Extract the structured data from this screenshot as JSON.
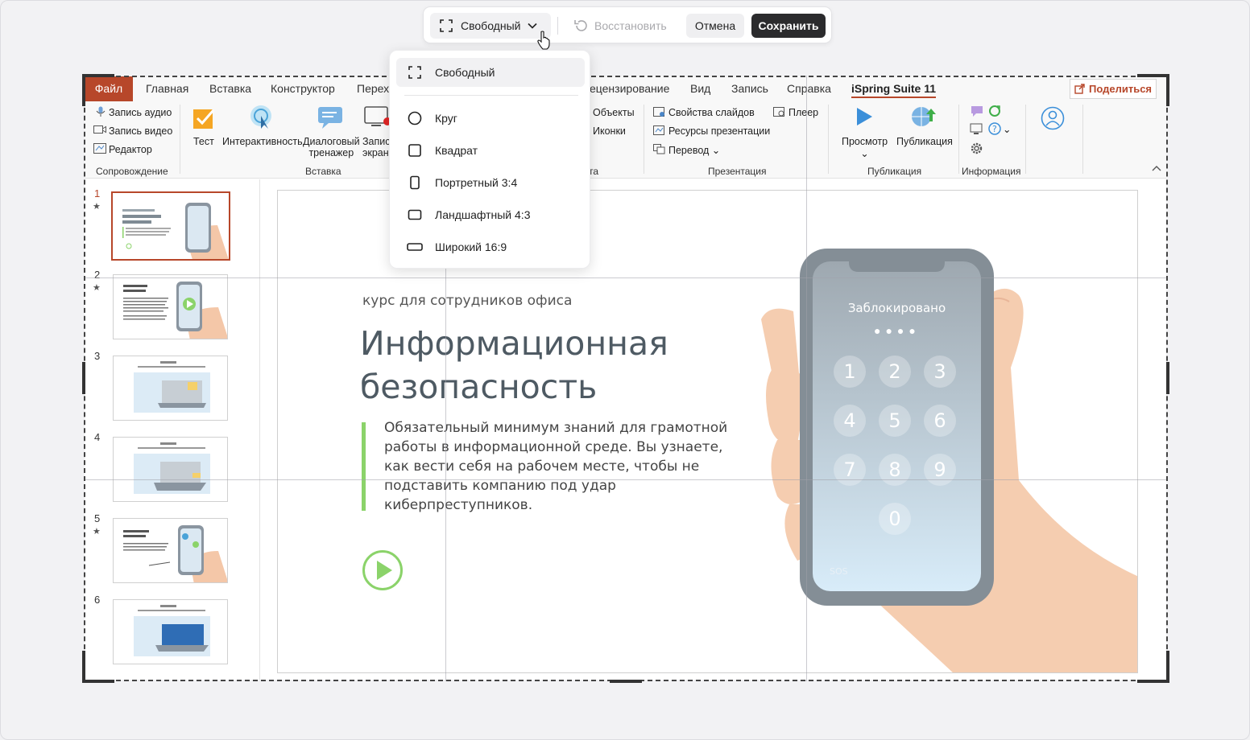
{
  "toolbar": {
    "mode_label": "Свободный",
    "restore_label": "Восстановить",
    "cancel_label": "Отмена",
    "save_label": "Сохранить"
  },
  "dropdown": {
    "items": [
      {
        "label": "Свободный",
        "icon": "free-crop-icon"
      },
      {
        "label": "Круг",
        "icon": "circle-icon"
      },
      {
        "label": "Квадрат",
        "icon": "square-icon"
      },
      {
        "label": "Портретный 3:4",
        "icon": "portrait-icon"
      },
      {
        "label": "Ландшафтный 4:3",
        "icon": "landscape-icon"
      },
      {
        "label": "Широкий 16:9",
        "icon": "wide-icon"
      }
    ]
  },
  "ribbon": {
    "tabs": [
      "Файл",
      "Главная",
      "Вставка",
      "Конструктор",
      "Перехо",
      "ецензирование",
      "Вид",
      "Запись",
      "Справка",
      "iSpring Suite 11"
    ],
    "share_label": "Поделиться",
    "accompaniment": {
      "items": [
        "Запись аудио",
        "Запись видео",
        "Редактор"
      ],
      "group": "Сопровождение"
    },
    "insert": {
      "test": "Тест",
      "interactivity": "Интерактивность",
      "dialog_1": "Диалоговый",
      "dialog_2": "тренажер",
      "record_1": "Запис",
      "record_2": "экран",
      "group": "Вставка"
    },
    "objects": {
      "objects": "Объекты",
      "icons": "Иконки",
      "group_fragment": "та"
    },
    "presentation": {
      "slide_props": "Свойства слайдов",
      "resources": "Ресурсы презентации",
      "translate": "Перевод",
      "player": "Плеер",
      "group": "Презентация"
    },
    "publish": {
      "preview": "Просмотр",
      "publish": "Публикация",
      "group": "Публикация"
    },
    "info": {
      "group": "Информация"
    }
  },
  "thumbnails": [
    {
      "num": "1",
      "star": true
    },
    {
      "num": "2",
      "star": true
    },
    {
      "num": "3",
      "star": false
    },
    {
      "num": "4",
      "star": false
    },
    {
      "num": "5",
      "star": true
    },
    {
      "num": "6",
      "star": false
    }
  ],
  "slide": {
    "subtitle": "курс для сотрудников офиса",
    "title": "Информационная безопасность",
    "description": "Обязательный минимум знаний для грамотной работы в информационной среде. Вы узнаете, как вести себя на рабочем месте, чтобы не подставить компанию под удар киберпреступников.",
    "phone_locked": "Заблокировано",
    "keypad": [
      "1",
      "2",
      "3",
      "4",
      "5",
      "6",
      "7",
      "8",
      "9",
      "0"
    ],
    "sos": "SOS"
  },
  "colors": {
    "accent": "#b7472a",
    "green": "#8bd36a",
    "dark_button": "#2b2b2d"
  }
}
